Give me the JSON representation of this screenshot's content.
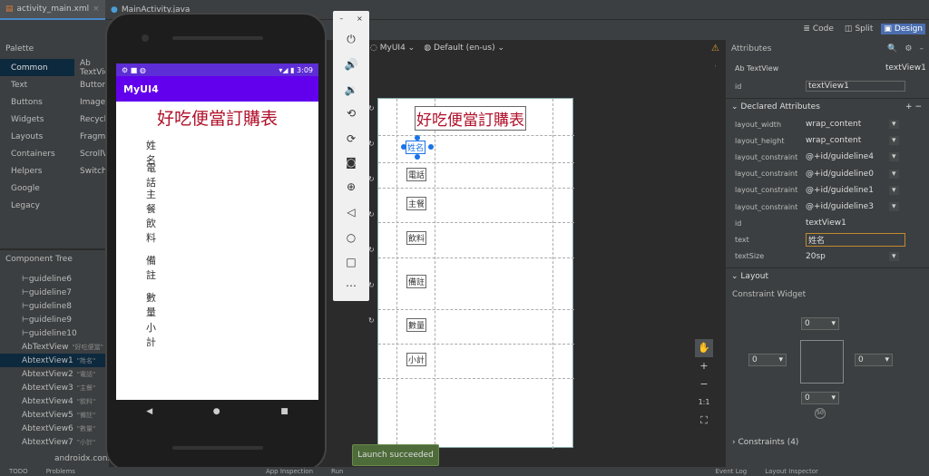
{
  "tabs": [
    {
      "label": "activity_main.xml"
    },
    {
      "label": "MainActivity.java"
    }
  ],
  "view_modes": {
    "code": "Code",
    "split": "Split",
    "design": "Design"
  },
  "design_toolbar": {
    "device": "MyUI4",
    "locale": "Default (en-us)"
  },
  "palette": {
    "title": "Palette",
    "categories": [
      "Common",
      "Text",
      "Buttons",
      "Widgets",
      "Layouts",
      "Containers",
      "Helpers",
      "Google",
      "Legacy"
    ],
    "items": [
      "Ab TextView",
      "Button",
      "ImageView",
      "RecyclerView",
      "FragmentContainerView",
      "ScrollView",
      "Switch"
    ]
  },
  "component_tree": {
    "title": "Component Tree",
    "rows": [
      {
        "icon": "⊢",
        "label": "guideline6",
        "hint": ""
      },
      {
        "icon": "⊢",
        "label": "guideline7",
        "hint": ""
      },
      {
        "icon": "⊢",
        "label": "guideline8",
        "hint": ""
      },
      {
        "icon": "⊢",
        "label": "guideline9",
        "hint": ""
      },
      {
        "icon": "⊢",
        "label": "guideline10",
        "hint": ""
      },
      {
        "icon": "Ab",
        "label": "TextView",
        "hint": "\"好吃便當\""
      },
      {
        "icon": "Ab",
        "label": "textView1",
        "hint": "\"姓名\""
      },
      {
        "icon": "Ab",
        "label": "textView2",
        "hint": "\"電話\""
      },
      {
        "icon": "Ab",
        "label": "textView3",
        "hint": "\"主餐\""
      },
      {
        "icon": "Ab",
        "label": "textView4",
        "hint": "\"飲料\""
      },
      {
        "icon": "Ab",
        "label": "textView5",
        "hint": "\"備註\""
      },
      {
        "icon": "Ab",
        "label": "textView6",
        "hint": "\"數量\""
      },
      {
        "icon": "Ab",
        "label": "textView7",
        "hint": "\"小計\""
      }
    ],
    "footer": "androidx.cons"
  },
  "phone": {
    "time": "3:09",
    "app_title": "MyUI4",
    "heading": "好吃便當訂購表",
    "labels": [
      "姓名",
      "電話",
      "主餐",
      "飲料",
      "備註",
      "數量",
      "小計"
    ]
  },
  "blueprint": {
    "heading": "好吃便當訂購表",
    "selected": "姓名",
    "labels": [
      "電話",
      "主餐",
      "飲料",
      "備註",
      "數量",
      "小計"
    ]
  },
  "attributes": {
    "title": "Attributes",
    "widget_type": "TextView",
    "widget_id": "textView1",
    "id_label": "id",
    "id_value": "textView1",
    "declared_title": "Declared Attributes",
    "declared": [
      {
        "key": "layout_width",
        "value": "wrap_content"
      },
      {
        "key": "layout_height",
        "value": "wrap_content"
      },
      {
        "key": "layout_constraint...",
        "value": "@+id/guideline4"
      },
      {
        "key": "layout_constraint...",
        "value": "@+id/guideline0"
      },
      {
        "key": "layout_constraint...",
        "value": "@+id/guideline1"
      },
      {
        "key": "layout_constraint...",
        "value": "@+id/guideline3"
      },
      {
        "key": "id",
        "value": "textView1"
      },
      {
        "key": "text",
        "value": "姓名"
      },
      {
        "key": "textSize",
        "value": "20sp"
      }
    ],
    "layout_title": "Layout",
    "constraint_widget": "Constraint Widget",
    "margins": {
      "top": "0",
      "left": "0",
      "right": "0",
      "bottom": "0",
      "bias": "50"
    },
    "constraints": "Constraints (4)"
  },
  "bottom": {
    "items": [
      "TODO",
      "Problems",
      "App Inspection",
      "Run",
      "Event Log",
      "Layout Inspector"
    ]
  },
  "toast": "Launch succeeded"
}
